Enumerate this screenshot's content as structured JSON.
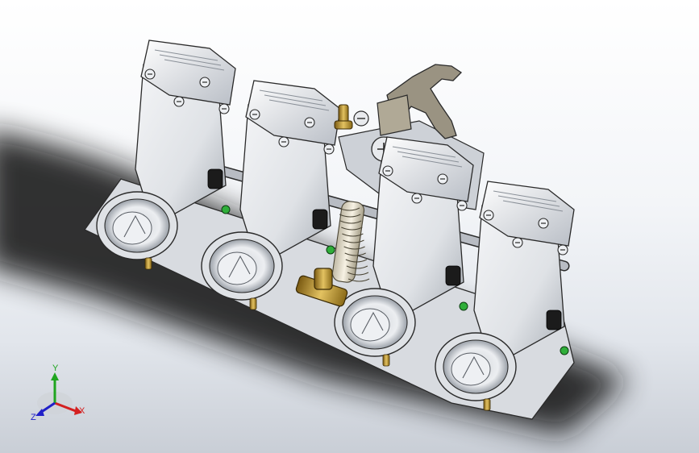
{
  "view": {
    "background": {
      "top": "#ffffff",
      "mid": "#eef0f3",
      "bottom": "#c9ced6"
    },
    "shadow_color": "#141414"
  },
  "model": {
    "body_color": "#e4e6ea",
    "body_shade": "#9aa0a8",
    "edge_color": "#2a2a2a",
    "brass_color": "#c8a23a",
    "green_color": "#2fae3a",
    "carb_bodies": 4
  },
  "triad": {
    "x_label": "X",
    "y_label": "Y",
    "z_label": "Z",
    "x_color": "#d42020",
    "y_color": "#1fa51f",
    "z_color": "#2020c8"
  }
}
